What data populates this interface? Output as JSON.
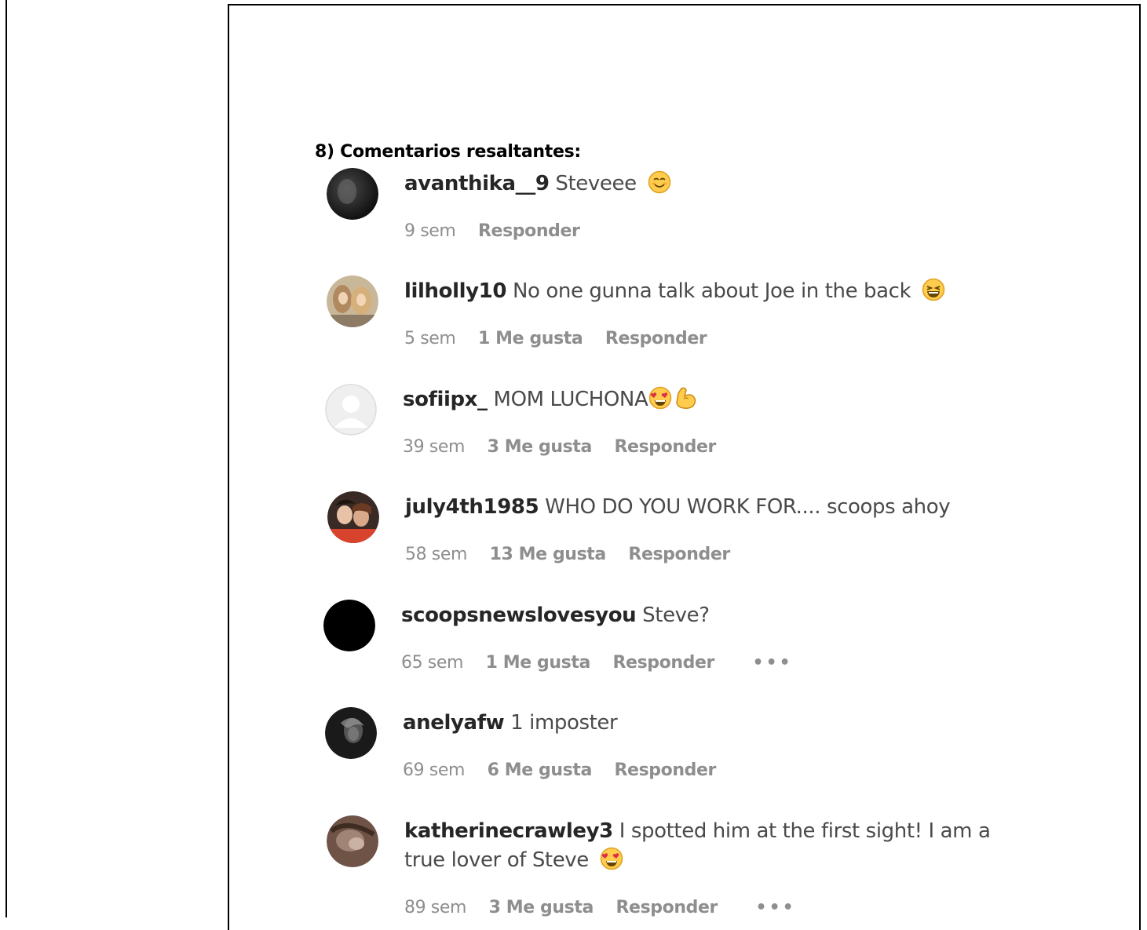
{
  "heading": "8) Comentarios resaltantes:",
  "comments": [
    {
      "username": "avanthika__9",
      "text": "Steveee",
      "emoji": "smiling-face-icon",
      "time": "9 sem",
      "likes": "",
      "reply": "Responder",
      "more": false
    },
    {
      "username": "lilholly10",
      "text": "No one gunna talk about Joe in the back",
      "emoji": "laughing-face-icon",
      "time": "5 sem",
      "likes": "1 Me gusta",
      "reply": "Responder",
      "more": false
    },
    {
      "username": "sofiipx_",
      "text": "MOM LUCHONA",
      "emoji": "heart-eyes-icon",
      "emoji2": "flexed-biceps-icon",
      "time": "39 sem",
      "likes": "3 Me gusta",
      "reply": "Responder",
      "more": false
    },
    {
      "username": "july4th1985",
      "text": "WHO DO YOU WORK FOR.... scoops ahoy",
      "time": "58 sem",
      "likes": "13 Me gusta",
      "reply": "Responder",
      "more": false
    },
    {
      "username": "scoopsnewslovesyou",
      "text": "Steve?",
      "time": "65 sem",
      "likes": "1 Me gusta",
      "reply": "Responder",
      "more": true,
      "more_label": "•••"
    },
    {
      "username": "anelyafw",
      "text": "1 imposter",
      "time": "69 sem",
      "likes": "6 Me gusta",
      "reply": "Responder",
      "more": false
    },
    {
      "username": "katherinecrawley3",
      "text": "I spotted him at the first sight! I am a true lover of Steve",
      "emoji": "heart-eyes-icon",
      "time": "89 sem",
      "likes": "3 Me gusta",
      "reply": "Responder",
      "more": true,
      "more_label": "•••"
    }
  ]
}
